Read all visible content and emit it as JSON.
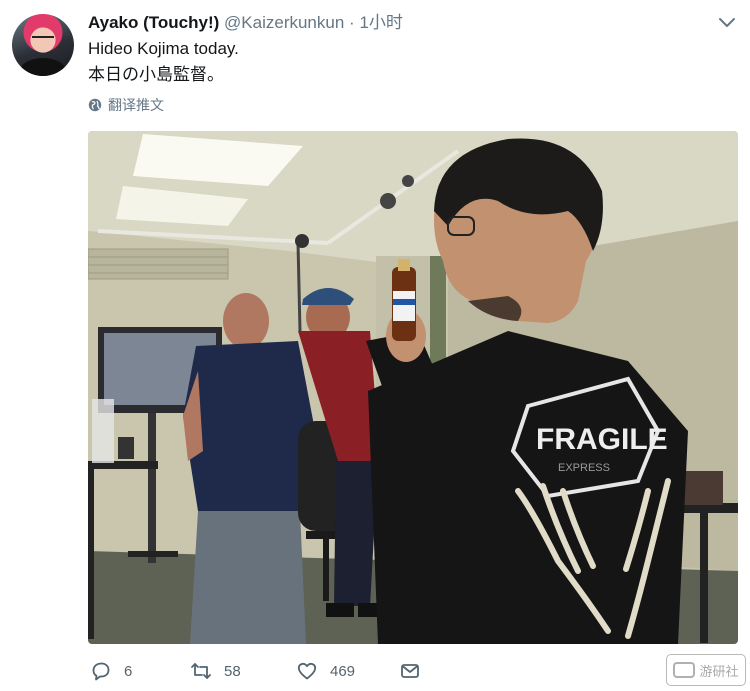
{
  "tweet": {
    "display_name": "Ayako (Touchy!)",
    "handle": "@Kaizerkunkun",
    "separator": "·",
    "time": "1小时",
    "text_line1": "Hideo Kojima today.",
    "text_line2": "本日の小島監督。",
    "translate_label": "翻译推文",
    "shirt_text": "FRAGILE",
    "shirt_subtext": "EXPRESS"
  },
  "icons": {
    "more": "chevron-down-icon",
    "translate": "globe-icon",
    "reply": "reply-bubble-icon",
    "retweet": "retweet-icon",
    "like": "heart-icon",
    "dm": "envelope-icon"
  },
  "actions": {
    "reply_count": "6",
    "retweet_count": "58",
    "like_count": "469"
  },
  "watermark": {
    "label": "游研社"
  },
  "colors": {
    "text": "#14171a",
    "secondary": "#657786",
    "icon": "#536471"
  }
}
